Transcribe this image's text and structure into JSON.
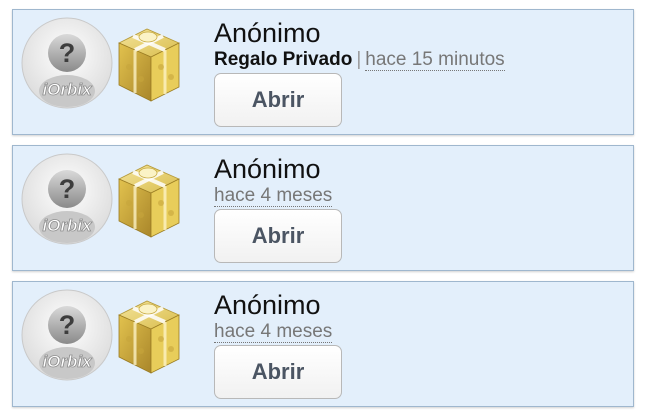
{
  "notifications": [
    {
      "sender": "Anónimo",
      "gift_type": "Regalo Privado",
      "separator": "|",
      "time": "hace 15 minutos",
      "open_label": "Abrir",
      "avatar_icon": "anonymous-user-icon",
      "avatar_brand": "iOrbix",
      "gift_icon": "gift-box-icon"
    },
    {
      "sender": "Anónimo",
      "time": "hace 4 meses",
      "open_label": "Abrir",
      "avatar_icon": "anonymous-user-icon",
      "avatar_brand": "iOrbix",
      "gift_icon": "gift-box-icon"
    },
    {
      "sender": "Anónimo",
      "time": "hace 4 meses",
      "open_label": "Abrir",
      "avatar_icon": "anonymous-user-icon",
      "avatar_brand": "iOrbix",
      "gift_icon": "gift-box-icon"
    }
  ],
  "colors": {
    "card_background": "#e3effb",
    "card_border": "#9fb7ce",
    "button_text": "#4b5563",
    "gift_gold": "#e6c95a"
  }
}
